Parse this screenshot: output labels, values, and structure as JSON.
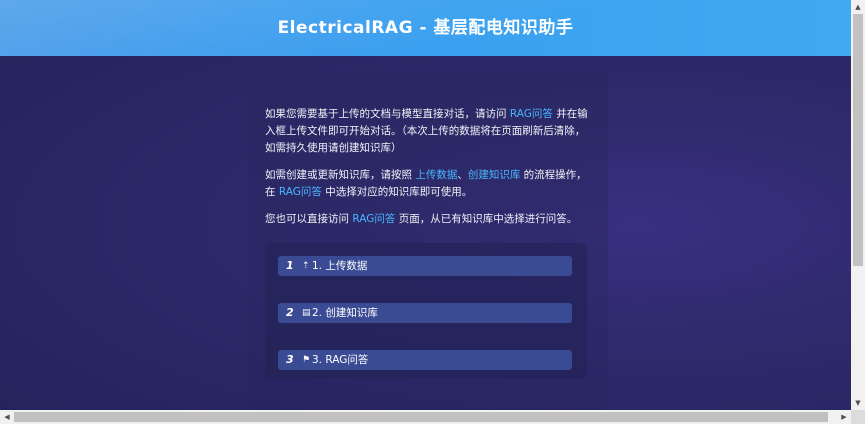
{
  "header": {
    "title": "ElectricalRAG - 基层配电知识助手"
  },
  "intro": {
    "p1_a": "如果您需要基于上传的文档与模型直接对话，请访问 ",
    "p1_link": "RAG问答",
    "p1_b": " 并在输入框上传文件即可开始对话。（本次上传的数据将在页面刷新后清除，如需持久使用请创建知识库）",
    "p2_a": "如需创建或更新知识库，请按照 ",
    "p2_link1": "上传数据",
    "p2_sep": "、",
    "p2_link2": "创建知识库",
    "p2_b": " 的流程操作，在 ",
    "p2_link3": "RAG问答",
    "p2_c": " 中选择对应的知识库即可使用。",
    "p3_a": "您也可以直接访问 ",
    "p3_link": "RAG问答",
    "p3_b": " 页面，从已有知识库中选择进行问答。"
  },
  "steps": [
    {
      "num": "1",
      "icon_name": "upload-icon",
      "icon": "⇡",
      "label": "1. 上传数据"
    },
    {
      "num": "2",
      "icon_name": "database-icon",
      "icon": "▤",
      "label": "2. 创建知识库"
    },
    {
      "num": "3",
      "icon_name": "flag-icon",
      "icon": "⚑",
      "label": "3. RAG问答"
    }
  ],
  "scroll": {
    "up": "▲",
    "down": "▼",
    "left": "◀",
    "right": "▶"
  }
}
